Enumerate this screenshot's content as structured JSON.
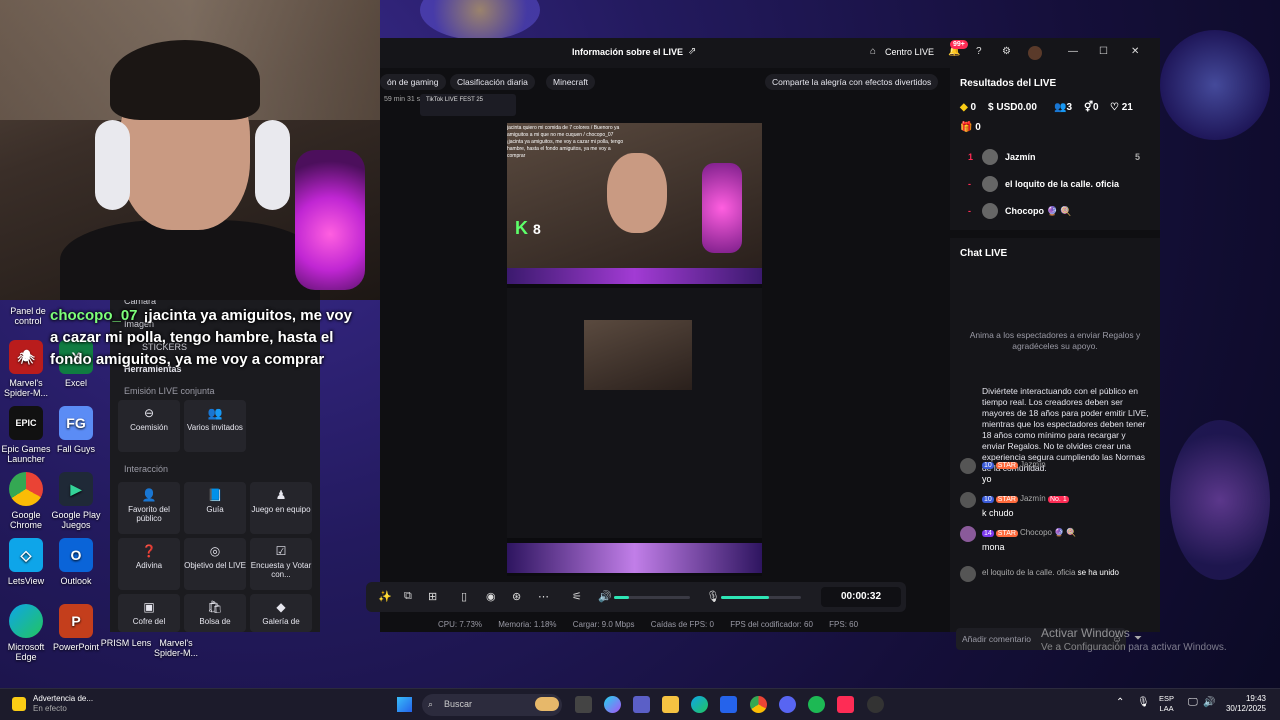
{
  "webcam_caption": {
    "username": "chocopo_07",
    "message": "¡jacinta ya amiguitos, me voy a cazar mi polla, tengo hambre, hasta el fondo amiguitos, ya me voy a comprar"
  },
  "desktop_icons": [
    {
      "label": "Panel de control",
      "icon": "control-panel-icon"
    },
    {
      "label": "Marvel's Spider-M...",
      "icon": "spiderman-icon"
    },
    {
      "label": "Excel",
      "icon": "excel-icon"
    },
    {
      "label": "Epic Games Launcher",
      "icon": "epic-games-icon"
    },
    {
      "label": "Fall Guys",
      "icon": "fall-guys-icon"
    },
    {
      "label": "Google Chrome",
      "icon": "chrome-icon"
    },
    {
      "label": "Google Play Juegos",
      "icon": "google-play-games-icon"
    },
    {
      "label": "LetsView",
      "icon": "letsview-icon"
    },
    {
      "label": "Outlook",
      "icon": "outlook-icon"
    },
    {
      "label": "Microsoft Edge",
      "icon": "edge-icon"
    },
    {
      "label": "PowerPoint",
      "icon": "powerpoint-icon"
    },
    {
      "label": "PRISM Lens",
      "icon": "prism-lens-icon"
    },
    {
      "label": "Marvel's Spider-M...",
      "icon": "spiderman-icon"
    }
  ],
  "tools_panel": {
    "ghost_items": [
      "Cámara",
      "Imagen",
      "STICKERS"
    ],
    "herramientas": "Herramientas",
    "emision_title": "Emisión LIVE conjunta",
    "emision": [
      {
        "label": "Coemisión"
      },
      {
        "label": "Varios invitados"
      }
    ],
    "interaccion_title": "Interacción",
    "interaccion": [
      {
        "label": "Favorito del público"
      },
      {
        "label": "Guía"
      },
      {
        "label": "Juego en equipo"
      },
      {
        "label": "Adivina"
      },
      {
        "label": "Objetivo del LIVE"
      },
      {
        "label": "Encuesta y Votar con..."
      },
      {
        "label": "Cofre del"
      },
      {
        "label": "Bolsa de"
      },
      {
        "label": "Galería de"
      }
    ]
  },
  "app": {
    "title": "Información sobre el LIVE",
    "centro": "Centro LIVE",
    "notif_badge": "99+",
    "chips": [
      "ón de gaming",
      "Clasificación diaria",
      "Minecraft"
    ],
    "chip_right": "Comparte la alegría con efectos divertidos",
    "timer_small": "59 min 31 s",
    "fest_label": "TikTok LIVE FEST 25",
    "preview": {
      "k_count": "8",
      "mini_chat": "jacinta quiero mi comida de 7 colores / Buenoro ya amiguitos a mi que no me cuquen / chocopo_07 ¡jacinta ya amiguitos, me voy a cazar mi polla, tengo hambre, hasta el fondo amiguitos, ya me voy a comprar"
    },
    "controls": {
      "timer": "00:00:32",
      "speaker_level": 0.2,
      "mic_level": 0.6
    },
    "stats": {
      "cpu": "CPU: 7.73%",
      "memoria": "Memoria: 1.18%",
      "cargar": "Cargar: 9.0 Mbps",
      "caidas": "Caídas de FPS: 0",
      "codificador": "FPS del codificador: 60",
      "fps": "FPS: 60"
    },
    "results": {
      "title": "Resultados del LIVE",
      "diamonds": "0",
      "usd": "USD0.00",
      "viewers": "3",
      "followers": "0",
      "likes": "21",
      "gifts": "0",
      "ranking": [
        {
          "rank": "1",
          "name": "Jazmín",
          "count": "5"
        },
        {
          "rank": "-",
          "name": "el loquito de la calle. oficia",
          "count": ""
        },
        {
          "rank": "-",
          "name": "Chocopo 🔮 🍭",
          "count": ""
        }
      ]
    },
    "chat": {
      "title": "Chat LIVE",
      "hint": "Anima a los espectadores a enviar Regalos y agradéceles su apoyo.",
      "rules": "Diviértete interactuando con el público en tiempo real. Los creadores deben ser mayores de 18 años para poder emitir LIVE, mientras que los espectadores deben tener 18 años como mínimo para recargar y enviar Regalos. No te olvides crear una experiencia segura cumpliendo las Normas de la comunidad.",
      "messages": [
        {
          "level": "10",
          "star": "STAR",
          "user": "Jazmín",
          "no1": "",
          "text": "yo"
        },
        {
          "level": "10",
          "star": "STAR",
          "user": "Jazmín",
          "no1": "No. 1",
          "text": "k chudo"
        },
        {
          "level": "14",
          "star": "STAR",
          "user": "Chocopo 🔮 🍭",
          "no1": "",
          "text": "mona"
        }
      ],
      "join": {
        "user": "el loquito de la calle. oficia",
        "text": "se ha unido"
      },
      "comment_placeholder": "Añadir comentario"
    }
  },
  "watermark": {
    "line1": "Activar Windows",
    "line2": "Ve a Configuración para activar Windows."
  },
  "taskbar": {
    "warning_title": "Advertencia de...",
    "warning_sub": "En efecto",
    "search": "Buscar",
    "lang1": "ESP",
    "lang2": "LAA",
    "time": "19:43",
    "date": "30/12/2025"
  }
}
